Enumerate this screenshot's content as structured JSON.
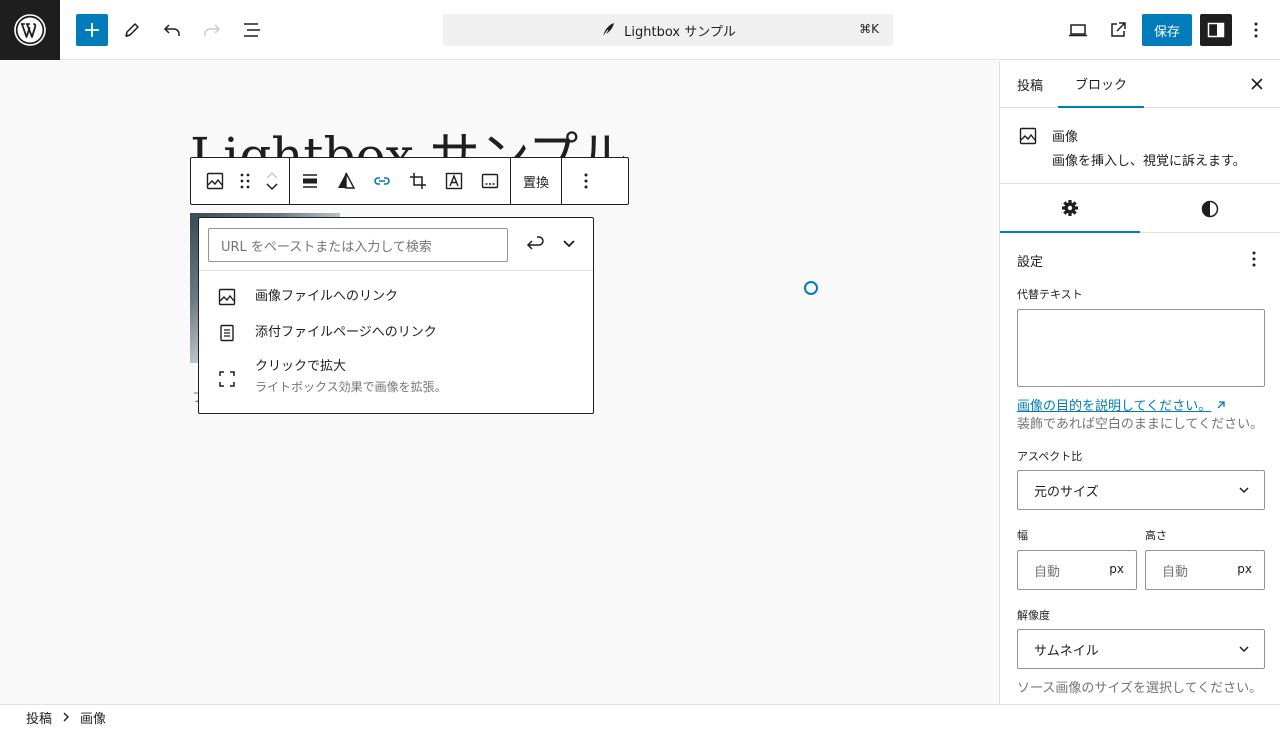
{
  "header": {
    "document_title": "Lightbox サンプル",
    "shortcut": "⌘K",
    "save_label": "保存"
  },
  "editor": {
    "post_title": "Lightbox サンプル",
    "caption_hint": "フ",
    "toolbar": {
      "replace_label": "置換"
    },
    "link_popover": {
      "placeholder": "URL をペーストまたは入力して検索",
      "items": [
        {
          "label": "画像ファイルへのリンク",
          "icon": "image-icon"
        },
        {
          "label": "添付ファイルページへのリンク",
          "icon": "page-icon"
        },
        {
          "label": "クリックで拡大",
          "description": "ライトボックス効果で画像を拡張。",
          "icon": "fullscreen-icon"
        }
      ]
    }
  },
  "sidebar": {
    "tabs": [
      "投稿",
      "ブロック"
    ],
    "active_tab": "ブロック",
    "block_card": {
      "title": "画像",
      "description": "画像を挿入し、視覚に訴えます。"
    },
    "panel_title": "設定",
    "alt": {
      "label": "代替テキスト",
      "link": "画像の目的を説明してください。",
      "help": "装飾であれば空白のままにしてください。"
    },
    "aspect": {
      "label": "アスペクト比",
      "value": "元のサイズ"
    },
    "width": {
      "label": "幅",
      "placeholder": "自動",
      "unit": "px"
    },
    "height": {
      "label": "高さ",
      "placeholder": "自動",
      "unit": "px"
    },
    "resolution": {
      "label": "解像度",
      "value": "サムネイル",
      "help": "ソース画像のサイズを選択してください。"
    }
  },
  "breadcrumb": [
    "投稿",
    "画像"
  ],
  "colors": {
    "accent": "#007cba",
    "dark": "#1e1e1e",
    "border": "#e0e0e0"
  }
}
